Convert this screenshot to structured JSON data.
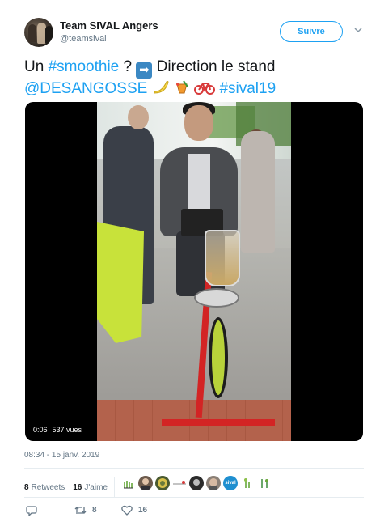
{
  "account": {
    "name": "Team SIVAL Angers",
    "handle": "@teamsival",
    "follow_label": "Suivre"
  },
  "tweet": {
    "text_plain_1": "Un ",
    "hashtag_1": "#smoothie",
    "text_plain_2": " ? ",
    "text_plain_3": " Direction le stand",
    "mention": "@DESANGOSSE",
    "hashtag_2": "#sival19"
  },
  "media": {
    "duration": "0:06",
    "views": "537 vues"
  },
  "timestamp": "08:34 - 15 janv. 2019",
  "stats": {
    "retweets_count": "8",
    "retweets_label": "Retweets",
    "likes_count": "16",
    "likes_label": "J'aime"
  },
  "likers": [
    {
      "icon": "plant-logo-avatar",
      "color": "#ffffff"
    },
    {
      "icon": "man-avatar",
      "color": "#6c5a4c"
    },
    {
      "icon": "badge-avatar",
      "color": "#4a5a30"
    },
    {
      "icon": "text-logo-avatar",
      "color": "#ffffff"
    },
    {
      "icon": "dark-avatar",
      "color": "#2b2b2b"
    },
    {
      "icon": "face-avatar",
      "color": "#8a7f76"
    },
    {
      "icon": "sival-avatar",
      "color": "#1f8fd0",
      "text": "sival"
    },
    {
      "icon": "plant-logo-avatar-2",
      "color": "#ffffff"
    },
    {
      "icon": "plant-logo-avatar-3",
      "color": "#ffffff"
    }
  ],
  "actions": {
    "reply_icon": "reply-icon",
    "retweet_count": "8",
    "like_count": "16"
  },
  "colors": {
    "accent": "#1da1f2",
    "muted": "#657786",
    "text": "#14171a"
  }
}
